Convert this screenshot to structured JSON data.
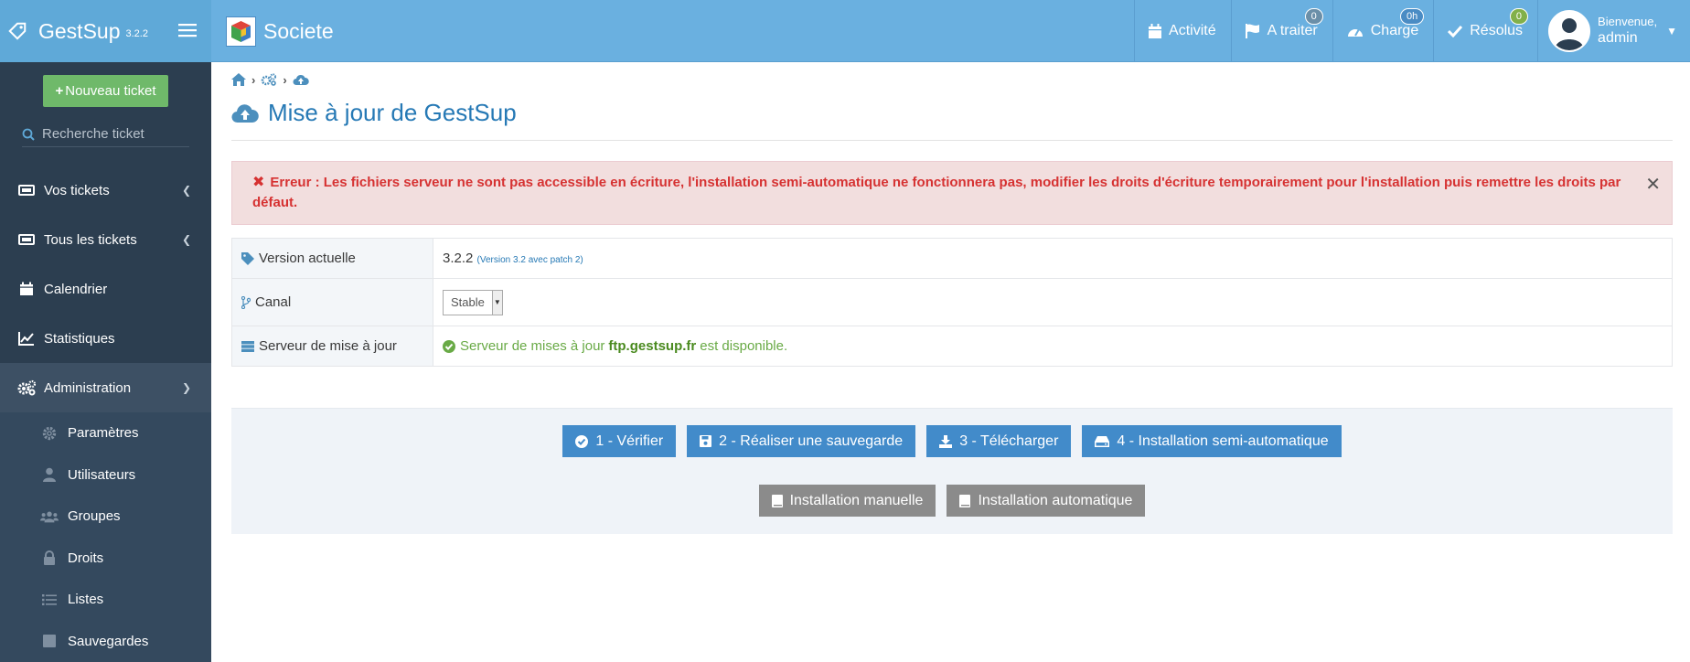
{
  "app": {
    "name": "GestSup",
    "version": "3.2.2"
  },
  "sidebar": {
    "new_ticket": "Nouveau ticket",
    "search_placeholder": "Recherche ticket",
    "items": [
      {
        "label": "Vos tickets",
        "icon": "ticket-icon"
      },
      {
        "label": "Tous les tickets",
        "icon": "ticket-icon"
      },
      {
        "label": "Calendrier",
        "icon": "calendar-icon"
      },
      {
        "label": "Statistiques",
        "icon": "chart-line-icon"
      },
      {
        "label": "Administration",
        "icon": "cogs-icon"
      }
    ],
    "sub_items": [
      {
        "label": "Paramètres",
        "icon": "cog-icon"
      },
      {
        "label": "Utilisateurs",
        "icon": "user-icon"
      },
      {
        "label": "Groupes",
        "icon": "users-icon"
      },
      {
        "label": "Droits",
        "icon": "lock-icon"
      },
      {
        "label": "Listes",
        "icon": "list-icon"
      },
      {
        "label": "Sauvegardes",
        "icon": "save-icon"
      }
    ]
  },
  "topbar": {
    "company": "Societe",
    "activity": "Activité",
    "todo": {
      "label": "A traiter",
      "badge": "0"
    },
    "charge": {
      "label": "Charge",
      "badge": "0h"
    },
    "resolved": {
      "label": "Résolus",
      "badge": "0"
    },
    "user": {
      "greeting": "Bienvenue,",
      "name": "admin"
    }
  },
  "main": {
    "title": "Mise à jour de GestSup",
    "alert": "Erreur : Les fichiers serveur ne sont pas accessible en écriture, l'installation semi-automatique ne fonctionnera pas, modifier les droits d'écriture temporairement pour l'installation puis remettre les droits par défaut.",
    "rows": {
      "version_label": "Version actuelle",
      "version_value": "3.2.2",
      "version_detail": "(Version 3.2 avec patch 2)",
      "channel_label": "Canal",
      "channel_value": "Stable",
      "server_label": "Serveur de mise à jour",
      "server_prefix": "Serveur de mises à jour",
      "server_host": "ftp.gestsup.fr",
      "server_suffix": "est disponible."
    },
    "buttons": {
      "verify": "1 - Vérifier",
      "backup": "2 - Réaliser une sauvegarde",
      "download": "3 - Télécharger",
      "semi_auto": "4 - Installation semi-automatique",
      "manual": "Installation manuelle",
      "auto": "Installation automatique"
    }
  },
  "colors": {
    "sidebar_bg": "#2c3e50",
    "topbar_bg": "#6ab0e0",
    "primary_button": "#428bca",
    "new_ticket_button": "#6fb96a",
    "alert_text": "#d63232",
    "success_text": "#69aa46"
  }
}
